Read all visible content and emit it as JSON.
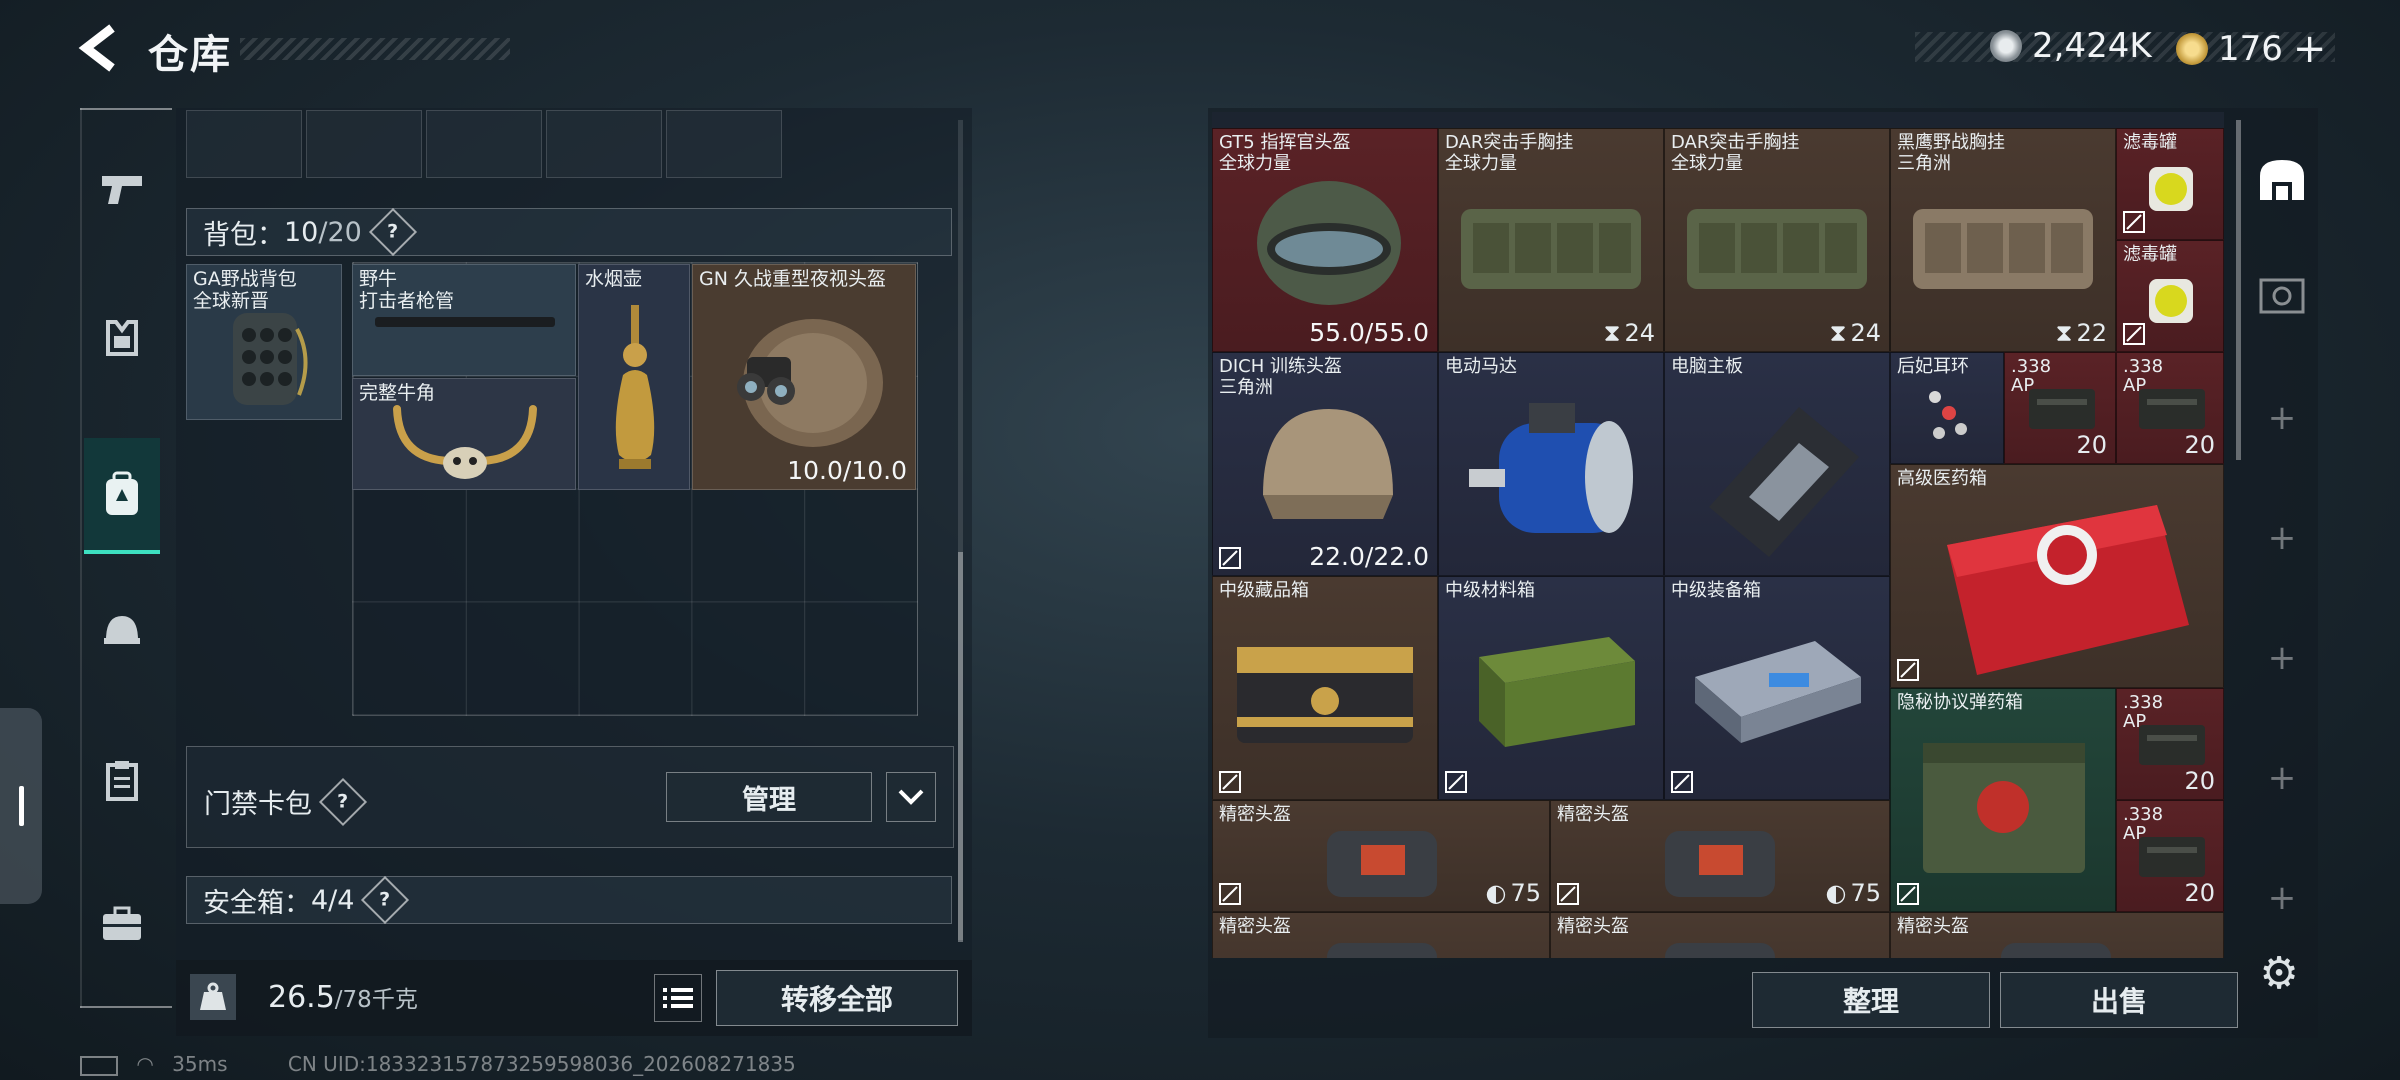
{
  "header": {
    "title": "仓库"
  },
  "currency": [
    {
      "icon": "silver-coin-icon",
      "value": "2,424K",
      "color": "#c9cfd3"
    },
    {
      "icon": "gold-coin-icon",
      "value": "176",
      "plus": "+",
      "color": "#d8b15a"
    }
  ],
  "rail": [
    {
      "icon": "pistol-icon"
    },
    {
      "icon": "armor-vest-icon"
    },
    {
      "icon": "backpack-icon",
      "active": true
    },
    {
      "icon": "helmet-icon"
    },
    {
      "icon": "clipboard-icon"
    },
    {
      "icon": "briefcase-icon"
    }
  ],
  "backpack": {
    "label": "背包：",
    "count": "10",
    "capacity": "/20",
    "help": "?",
    "equipped": {
      "name_line1": "GA野战背包",
      "name_line2": "全球新晋"
    },
    "items": [
      {
        "name": "野牛",
        "sub": "打击者枪管"
      },
      {
        "name": "水烟壶",
        "sub": ""
      },
      {
        "name": "GN 久战重型夜视头盔",
        "sub": "",
        "value": "10.0/10.0"
      },
      {
        "name": "完整牛角",
        "sub": ""
      }
    ]
  },
  "keycard": {
    "label": "门禁卡包",
    "help": "?",
    "manage": "管理"
  },
  "safebox": {
    "label": "安全箱：",
    "value": "4/4",
    "help": "?"
  },
  "weight": {
    "current": "26.5",
    "max": "/78千克",
    "icon": "kg-weight-icon"
  },
  "transfer_all": "转移全部",
  "status": {
    "ping": "35ms",
    "uid": "CN UID:18332315787325959803​6_202608271835"
  },
  "stash": {
    "cells": [
      {
        "id": "gt5",
        "name": "GT5 指挥官头盔",
        "sub": "全球力量",
        "value": "55.0/55.0",
        "color": "red"
      },
      {
        "id": "dar1",
        "name": "DAR突击手胸挂",
        "sub": "全球力量",
        "value": "24",
        "color": "brown"
      },
      {
        "id": "dar2",
        "name": "DAR突击手胸挂",
        "sub": "全球力量",
        "value": "24",
        "color": "brown"
      },
      {
        "id": "blackhawk",
        "name": "黑鹰野战胸挂",
        "sub": "三角洲",
        "value": "22",
        "color": "brown"
      },
      {
        "id": "filter1",
        "name": "滤毒罐",
        "sub": "",
        "value": "",
        "color": "red"
      },
      {
        "id": "filter2",
        "name": "滤毒罐",
        "sub": "",
        "value": "",
        "color": "red"
      },
      {
        "id": "dich",
        "name": "DICH 训练头盔",
        "sub": "三角洲",
        "value": "22.0/22.0",
        "color": "blue"
      },
      {
        "id": "motor",
        "name": "电动马达",
        "sub": "",
        "value": "",
        "color": "blue"
      },
      {
        "id": "mobo",
        "name": "电脑主板",
        "sub": "",
        "value": "",
        "color": "blue"
      },
      {
        "id": "earring",
        "name": "后妃耳环",
        "sub": "",
        "value": "",
        "color": "blue"
      },
      {
        "id": "ammo1",
        "name": ".338",
        "sub": "AP",
        "value": "20",
        "color": "red"
      },
      {
        "id": "ammo2",
        "name": ".338",
        "sub": "AP",
        "value": "20",
        "color": "red"
      },
      {
        "id": "medkit",
        "name": "高级医药箱",
        "sub": "",
        "value": "",
        "color": "brown"
      },
      {
        "id": "box1",
        "name": "中级藏品箱",
        "sub": "",
        "value": "",
        "color": "brown"
      },
      {
        "id": "box2",
        "name": "中级材料箱",
        "sub": "",
        "value": "",
        "color": "blue"
      },
      {
        "id": "box3",
        "name": "中级装备箱",
        "sub": "",
        "value": "",
        "color": "blue"
      },
      {
        "id": "ammobox",
        "name": "隐秘协议弹药箱",
        "sub": "",
        "value": "",
        "color": "green"
      },
      {
        "id": "ammo3",
        "name": ".338",
        "sub": "AP",
        "value": "20",
        "color": "red"
      },
      {
        "id": "ammo4",
        "name": ".338",
        "sub": "AP",
        "value": "20",
        "color": "red"
      },
      {
        "id": "bag1",
        "name": "精密头盔",
        "sub": "",
        "value": "75",
        "color": "brown"
      },
      {
        "id": "bag2",
        "name": "精密头盔",
        "sub": "",
        "value": "75",
        "color": "brown"
      },
      {
        "id": "bag3",
        "name": "精密头盔",
        "sub": "",
        "value": "",
        "color": "brown"
      },
      {
        "id": "bag4",
        "name": "精密头盔",
        "sub": "",
        "value": "",
        "color": "brown"
      },
      {
        "id": "bag5",
        "name": "精密头盔",
        "sub": "",
        "value": "",
        "color": "brown"
      }
    ]
  },
  "actions": {
    "sort": "整理",
    "sell": "出售"
  },
  "side_tabs": [
    {
      "icon": "stash-home-icon"
    },
    {
      "icon": "ticket-icon"
    },
    {
      "icon": "plus-icon"
    },
    {
      "icon": "plus-icon"
    },
    {
      "icon": "plus-icon"
    },
    {
      "icon": "plus-icon"
    },
    {
      "icon": "plus-icon"
    }
  ],
  "settings_icon": "gear-icon"
}
